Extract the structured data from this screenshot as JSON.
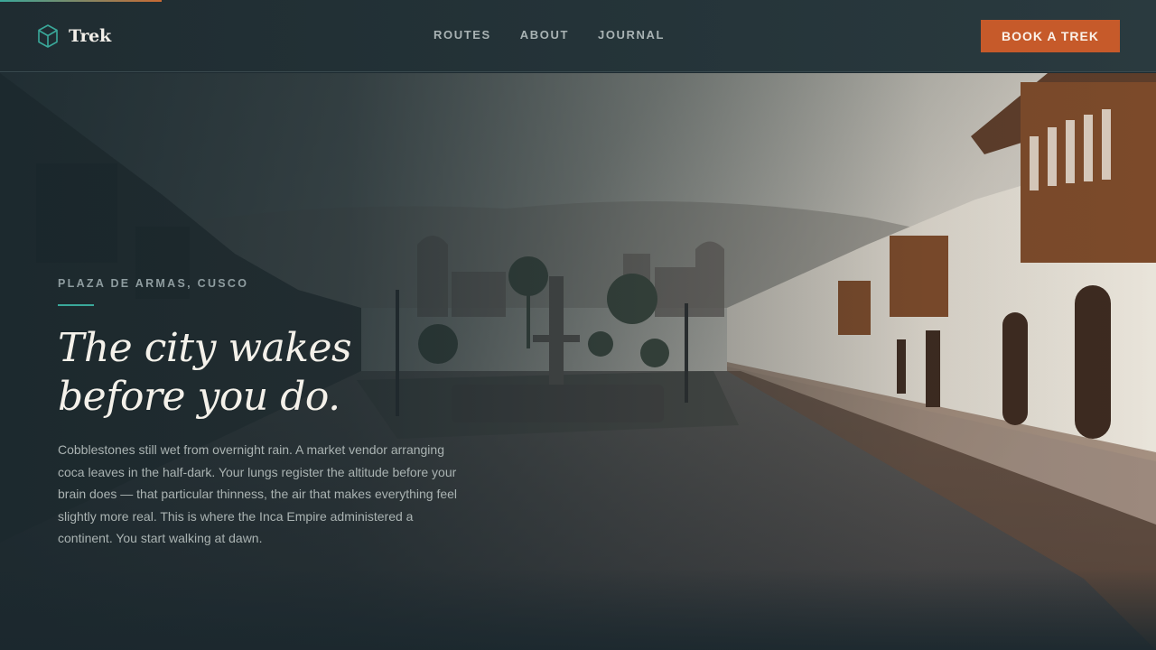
{
  "page": {
    "scroll_progress": 0.14
  },
  "header": {
    "brand_name": "Trek",
    "brand_icon": "hexagon-cube-icon",
    "nav": [
      {
        "label": "ROUTES"
      },
      {
        "label": "ABOUT"
      },
      {
        "label": "JOURNAL"
      }
    ],
    "cta_label": "BOOK A TREK"
  },
  "hero": {
    "eyebrow": "PLAZA DE ARMAS, CUSCO",
    "headline": "The city wakes before you do.",
    "body": "Cobblestones still wet from overnight rain. A market vendor arranging coca leaves in the half-dark. Your lungs register the altitude before your brain does — that particular thinness, the air that makes everything feel slightly more real. This is where the Inca Empire administered a continent. You start walking at dawn."
  },
  "colors": {
    "accent_teal": "#3aa89a",
    "accent_orange": "#c65a2a",
    "background": "#1f2c31"
  }
}
